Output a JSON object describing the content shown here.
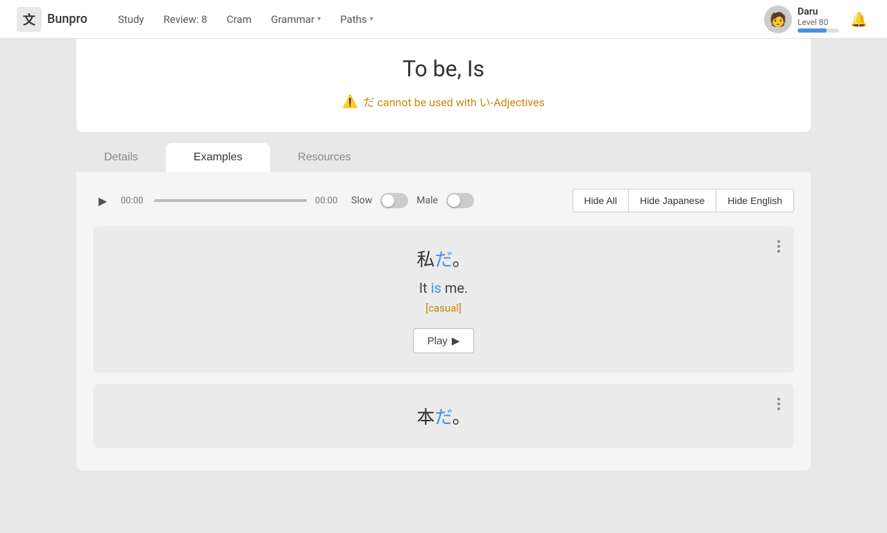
{
  "navbar": {
    "brand_icon": "文",
    "brand_name": "Bunpro",
    "nav_items": [
      {
        "label": "Study",
        "has_dropdown": false
      },
      {
        "label": "Review: 8",
        "has_dropdown": false
      },
      {
        "label": "Cram",
        "has_dropdown": false
      },
      {
        "label": "Grammar",
        "has_dropdown": true
      },
      {
        "label": "Paths",
        "has_dropdown": true
      }
    ],
    "user": {
      "name": "Daru",
      "level": "Level 80",
      "progress_percent": 70,
      "avatar_emoji": "🧑"
    }
  },
  "page": {
    "grammar_title": "To be, Is",
    "warning_text": "だ cannot be used with い-Adjectives"
  },
  "tabs": [
    {
      "label": "Details",
      "active": false
    },
    {
      "label": "Examples",
      "active": true
    },
    {
      "label": "Resources",
      "active": false
    }
  ],
  "audio": {
    "time_start": "00:00",
    "time_end": "00:00",
    "slow_label": "Slow",
    "male_label": "Male",
    "hide_all_label": "Hide All",
    "hide_japanese_label": "Hide Japanese",
    "hide_english_label": "Hide English"
  },
  "examples": [
    {
      "japanese": "私だ。",
      "japanese_pre": "私",
      "japanese_highlight": "だ",
      "japanese_post": "。",
      "english_pre": "It ",
      "english_highlight": "is",
      "english_post": " me.",
      "tag": "[casual]",
      "play_label": "Play"
    },
    {
      "japanese_pre": "本",
      "japanese_highlight": "だ",
      "japanese_post": "。",
      "english": "",
      "tag": ""
    }
  ]
}
